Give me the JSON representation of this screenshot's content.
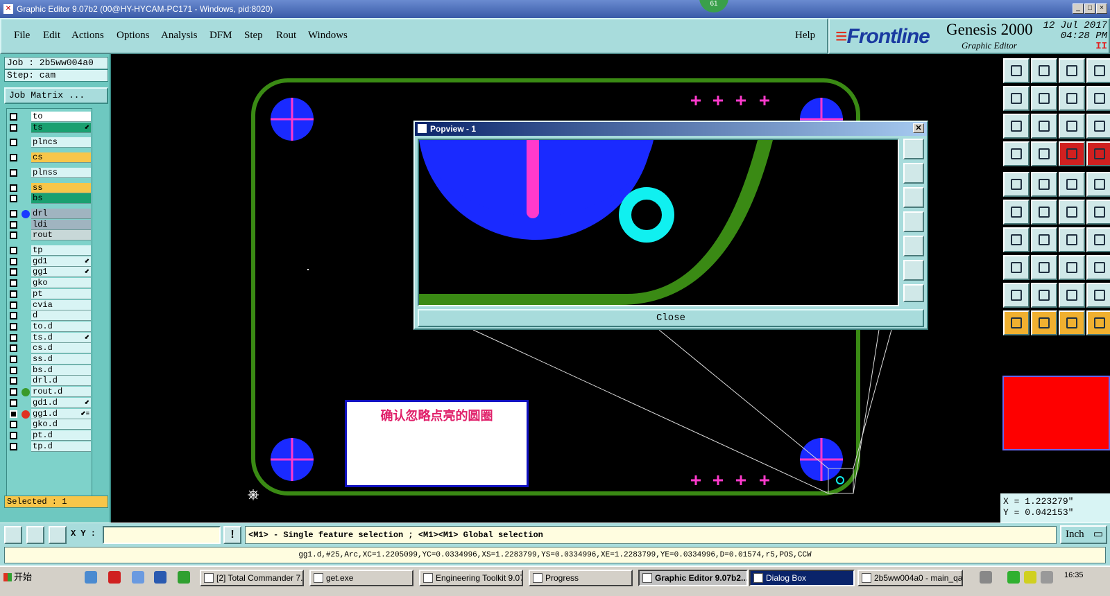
{
  "window": {
    "title": "Graphic Editor 9.07b2 (00@HY-HYCAM-PC171 - Windows, pid:8020)",
    "badge": "61",
    "min": "_",
    "max": "□",
    "close": "×"
  },
  "menu": [
    "File",
    "Edit",
    "Actions",
    "Options",
    "Analysis",
    "DFM",
    "Step",
    "Rout",
    "Windows"
  ],
  "help": "Help",
  "brand": {
    "logo_prefix": "F",
    "logo_rest": "rontline",
    "name": "Genesis 2000",
    "sub": "Graphic Editor",
    "date": "12 Jul 2017",
    "time": "04:28 PM",
    "pause": "II"
  },
  "job": {
    "label": "Job : 2b5ww004a0",
    "step": "Step: cam",
    "matrix": "Job Matrix ..."
  },
  "layers": [
    {
      "name": "to",
      "color": "#ffffff",
      "mark": ""
    },
    {
      "name": "ts",
      "color": "#1aa070",
      "mark": "⬋"
    },
    {
      "name": "plncs",
      "color": "#d8f4f4",
      "mark": ""
    },
    {
      "name": "cs",
      "color": "#f7c64a",
      "mark": ""
    },
    {
      "name": "plnss",
      "color": "#d8f4f4",
      "mark": ""
    },
    {
      "name": "ss",
      "color": "#f7c64a",
      "mark": ""
    },
    {
      "name": "bs",
      "color": "#1aa070",
      "mark": ""
    },
    {
      "name": "drl",
      "color": "#a0b4c0",
      "mark": "",
      "dot": "#1a3aff"
    },
    {
      "name": "ldi",
      "color": "#a0b4c0",
      "mark": ""
    },
    {
      "name": "rout",
      "color": "#c8d8d8",
      "mark": ""
    },
    {
      "name": "tp",
      "color": "#d8f4f4",
      "mark": ""
    },
    {
      "name": "gd1",
      "color": "#d8f4f4",
      "mark": "⬋"
    },
    {
      "name": "gg1",
      "color": "#d8f4f4",
      "mark": "⬋"
    },
    {
      "name": "gko",
      "color": "#d8f4f4",
      "mark": ""
    },
    {
      "name": "pt",
      "color": "#d8f4f4",
      "mark": ""
    },
    {
      "name": "cvia",
      "color": "#d8f4f4",
      "mark": ""
    },
    {
      "name": "d",
      "color": "#d8f4f4",
      "mark": ""
    },
    {
      "name": "to.d",
      "color": "#d8f4f4",
      "mark": ""
    },
    {
      "name": "ts.d",
      "color": "#d8f4f4",
      "mark": "⬋"
    },
    {
      "name": "cs.d",
      "color": "#d8f4f4",
      "mark": ""
    },
    {
      "name": "ss.d",
      "color": "#d8f4f4",
      "mark": ""
    },
    {
      "name": "bs.d",
      "color": "#d8f4f4",
      "mark": ""
    },
    {
      "name": "drl.d",
      "color": "#d8f4f4",
      "mark": ""
    },
    {
      "name": "rout.d",
      "color": "#d8f4f4",
      "mark": "",
      "dot": "#3a9a2a"
    },
    {
      "name": "gd1.d",
      "color": "#d8f4f4",
      "mark": "⬋"
    },
    {
      "name": "gg1.d",
      "color": "#d8f4f4",
      "mark": "⬋≡",
      "selected": true,
      "dot": "#e03020"
    },
    {
      "name": "gko.d",
      "color": "#d8f4f4",
      "mark": ""
    },
    {
      "name": "pt.d",
      "color": "#d8f4f4",
      "mark": ""
    },
    {
      "name": "tp.d",
      "color": "#d8f4f4",
      "mark": ""
    }
  ],
  "selected_label": "Selected : 1",
  "popview": {
    "title": "Popview - 1",
    "close": "Close"
  },
  "note": "确认忽略点亮的圆圈",
  "coords": {
    "x": "X =  1.223279\"",
    "y": "Y =  0.042153\""
  },
  "cmd": {
    "xy_label": "X Y :",
    "xy_value": "",
    "excl": "!",
    "message": "<M1> - Single feature selection ; <M1><M1> Global selection",
    "unit": "Inch"
  },
  "info": "gg1.d,#25,Arc,XC=1.2205099,YC=0.0334996,XS=1.2283799,YS=0.0334996,XE=1.2283799,YE=0.0334996,D=0.01574,r5,POS,CCW",
  "taskbar": {
    "start": "开始",
    "tasks": [
      "[2] Total Commander 7....",
      "get.exe",
      "Engineering Toolkit 9.07...",
      "Progress",
      "Graphic Editor 9.07b2...",
      "Dialog Box",
      "2b5ww004a0 - main_qa"
    ],
    "clock": "16:35"
  },
  "colors": {
    "board_outline": "#3a8a14",
    "pad": "#1a2aff",
    "pink": "#ff3acc",
    "cyan": "#10f0f0",
    "panel": "#a8dcdc"
  }
}
